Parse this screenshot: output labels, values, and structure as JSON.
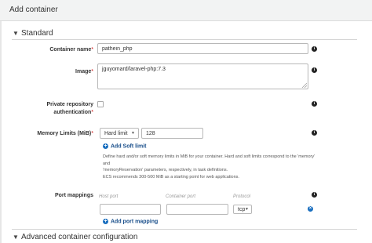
{
  "modal": {
    "title": "Add container"
  },
  "sections": {
    "standard": {
      "label": "Standard",
      "toggle": "▼"
    },
    "advanced": {
      "label": "Advanced container configuration",
      "toggle": "▼"
    }
  },
  "fields": {
    "container_name": {
      "label": "Container name",
      "required": "*",
      "value": "pathein_php"
    },
    "image": {
      "label": "Image",
      "required": "*",
      "value": "jguyomard/laravel-php:7.3"
    },
    "private_repo": {
      "label_line1": "Private repository",
      "label_line2": "authentication",
      "required": "*",
      "checked": false
    },
    "memory_limits": {
      "label": "Memory Limits (MiB)",
      "required": "*",
      "limit_type": "Hard limit",
      "value": "128",
      "add_soft_limit": "Add Soft limit",
      "help_line1": "Define hard and/or soft memory limits in MiB for your container. Hard and soft limits correspond to the 'memory' and",
      "help_line2": "'memoryReservation' parameters, respectively, in task definitions.",
      "help_line3": "ECS recommends 300-500 MiB as a starting point for web applications."
    },
    "port_mappings": {
      "label": "Port mappings",
      "col_host": "Host port",
      "col_container": "Container port",
      "col_protocol": "Protocol",
      "host_value": "",
      "container_value": "",
      "protocol": "tcp",
      "add_label": "Add port mapping"
    }
  },
  "icons": {
    "info": "info-icon",
    "add": "plus-circle-icon",
    "remove": "remove-icon"
  },
  "colors": {
    "link": "#1a4f8b",
    "accent": "#1a6fbf",
    "required": "#cc0000"
  }
}
